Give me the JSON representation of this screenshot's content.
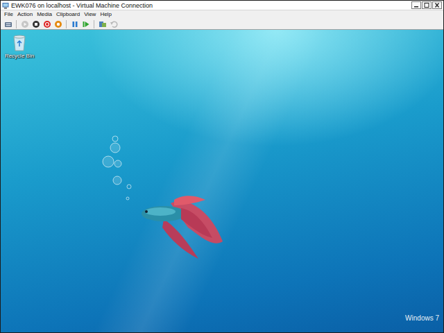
{
  "window": {
    "title": "EWK076 on localhost - Virtual Machine Connection"
  },
  "menu": [
    {
      "label": "File"
    },
    {
      "label": "Action"
    },
    {
      "label": "Media"
    },
    {
      "label": "Clipboard"
    },
    {
      "label": "View"
    },
    {
      "label": "Help"
    }
  ],
  "toolbar": [
    {
      "kind": "ctrl-alt-del",
      "disabled": false
    },
    {
      "kind": "separator",
      "disabled": false
    },
    {
      "kind": "start",
      "disabled": true
    },
    {
      "kind": "turn-off",
      "disabled": false
    },
    {
      "kind": "shut-down",
      "disabled": false
    },
    {
      "kind": "save",
      "disabled": false
    },
    {
      "kind": "separator",
      "disabled": false
    },
    {
      "kind": "pause",
      "disabled": false
    },
    {
      "kind": "reset",
      "disabled": false
    },
    {
      "kind": "separator",
      "disabled": false
    },
    {
      "kind": "snapshot",
      "disabled": false
    },
    {
      "kind": "revert",
      "disabled": true
    }
  ],
  "desktop": {
    "icons": [
      {
        "label": "Recycle Bin",
        "selected": false
      }
    ],
    "watermark": "Windows 7"
  }
}
